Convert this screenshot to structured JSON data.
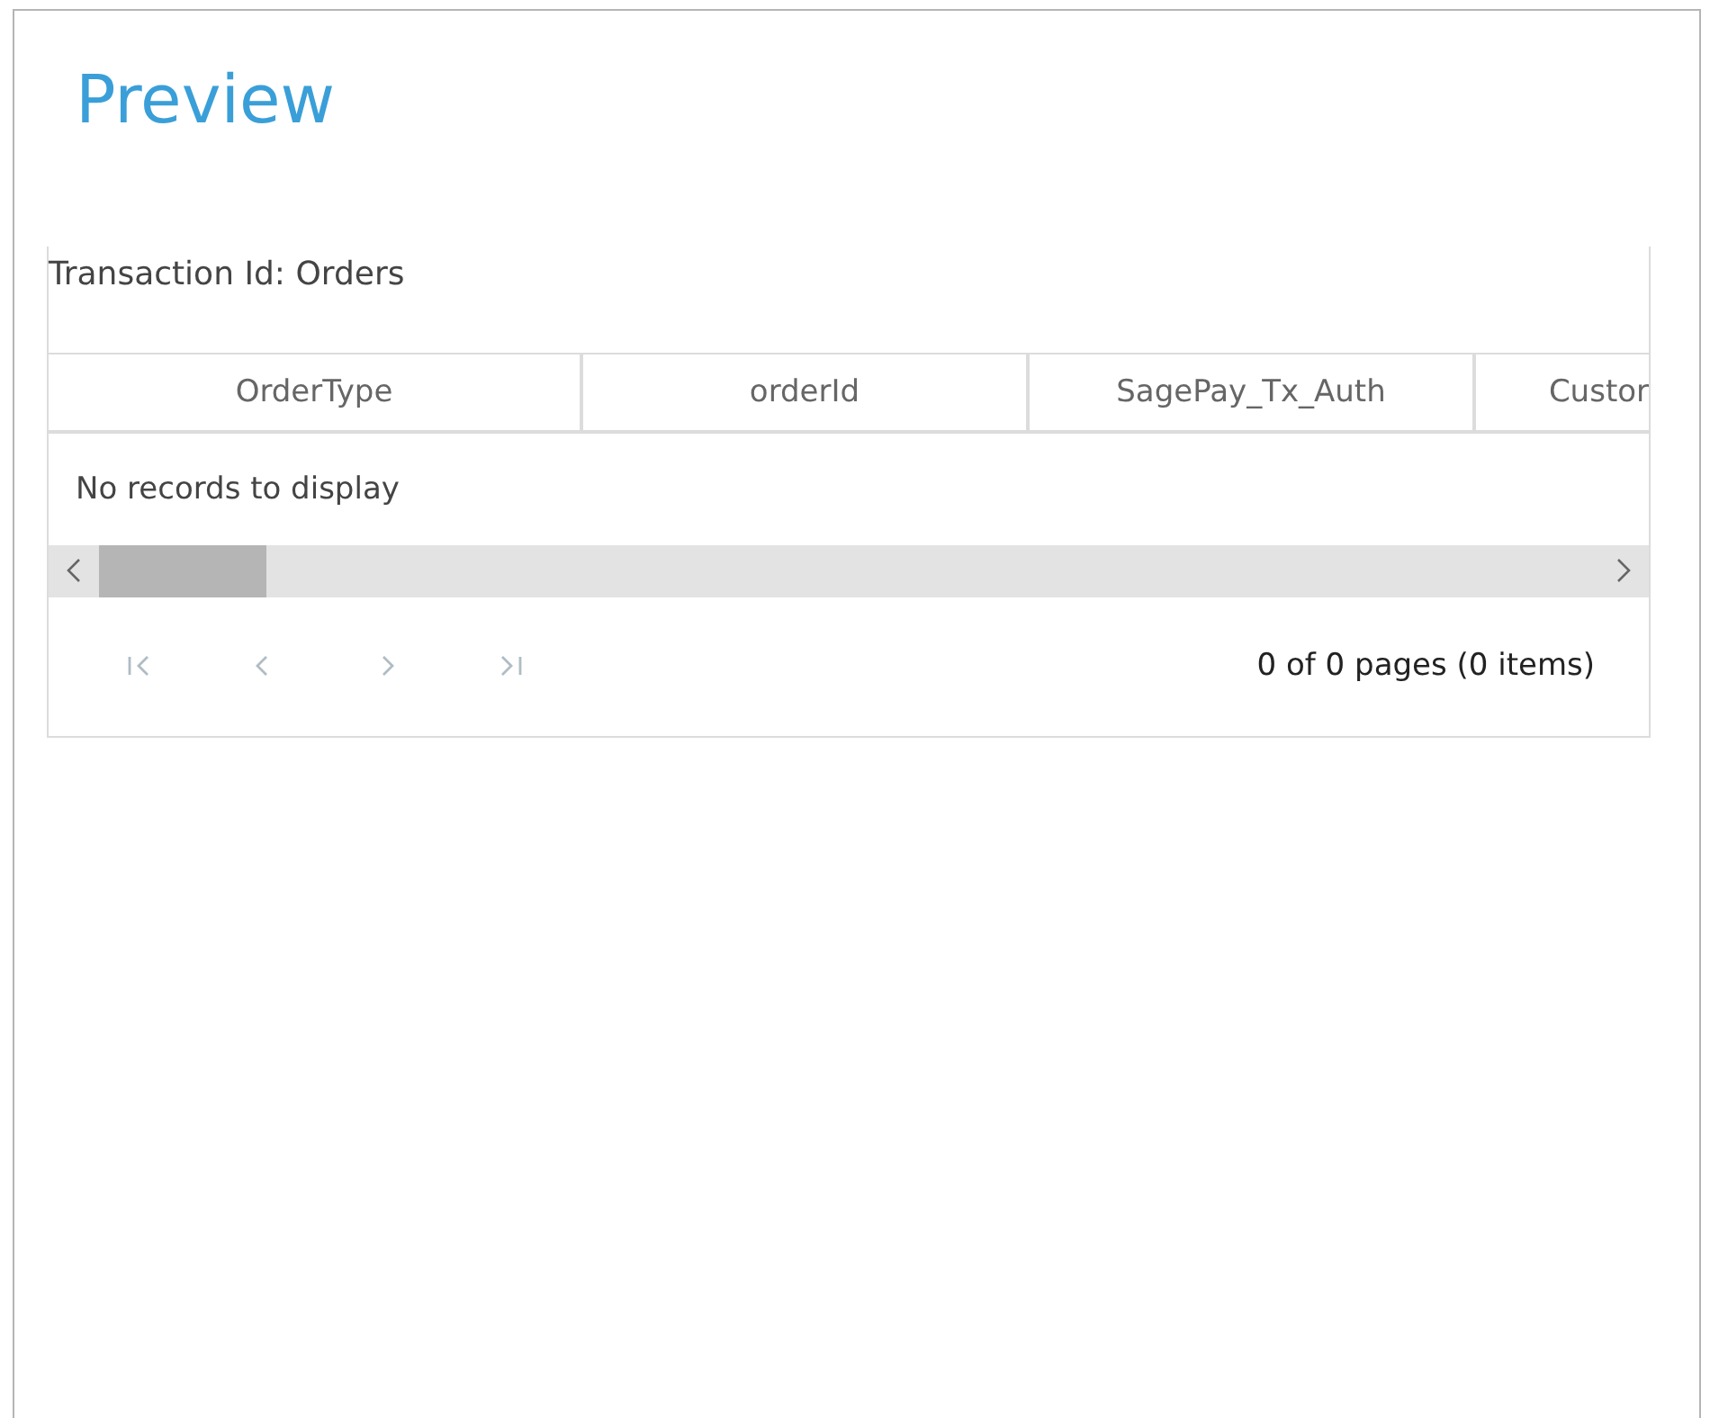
{
  "page": {
    "title": "Preview"
  },
  "grid": {
    "caption": "Transaction Id: Orders",
    "columns": [
      "OrderType",
      "orderId",
      "SagePay_Tx_Auth",
      "Custor"
    ],
    "empty_message": "No records to display",
    "pager": {
      "buttons": [
        {
          "kind": "first",
          "disabled": true
        },
        {
          "kind": "prev",
          "disabled": true
        },
        {
          "kind": "next",
          "disabled": true
        },
        {
          "kind": "last",
          "disabled": true
        }
      ],
      "info": "0 of 0 pages (0 items)"
    }
  }
}
